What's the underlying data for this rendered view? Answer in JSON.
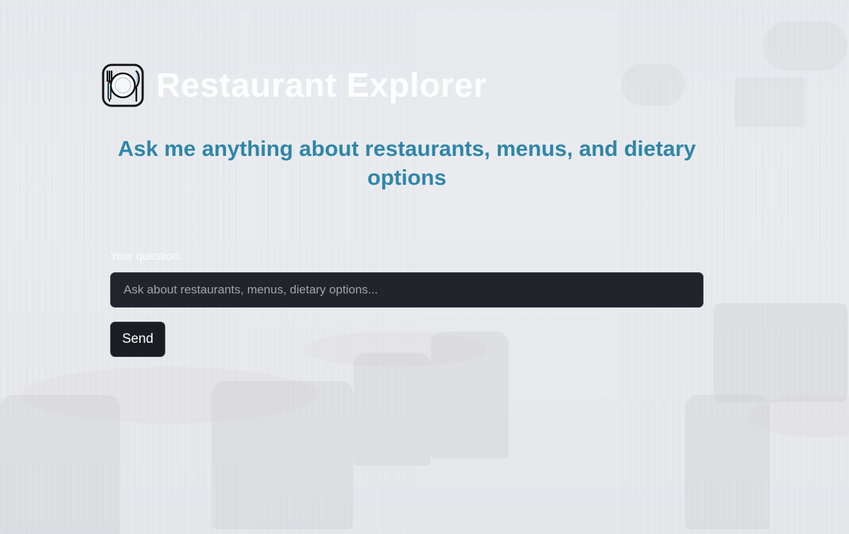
{
  "header": {
    "title": "Restaurant Explorer",
    "logo_icon": "plate-fork-knife-icon"
  },
  "main": {
    "subtitle": "Ask me anything about restaurants, menus, and dietary options",
    "question_label": "Your question:",
    "question_input": {
      "value": "",
      "placeholder": "Ask about restaurants, menus, dietary options..."
    },
    "send_label": "Send"
  },
  "colors": {
    "accent": "#2f86a8",
    "input_bg": "#22232b",
    "button_bg": "#1c1d24"
  }
}
